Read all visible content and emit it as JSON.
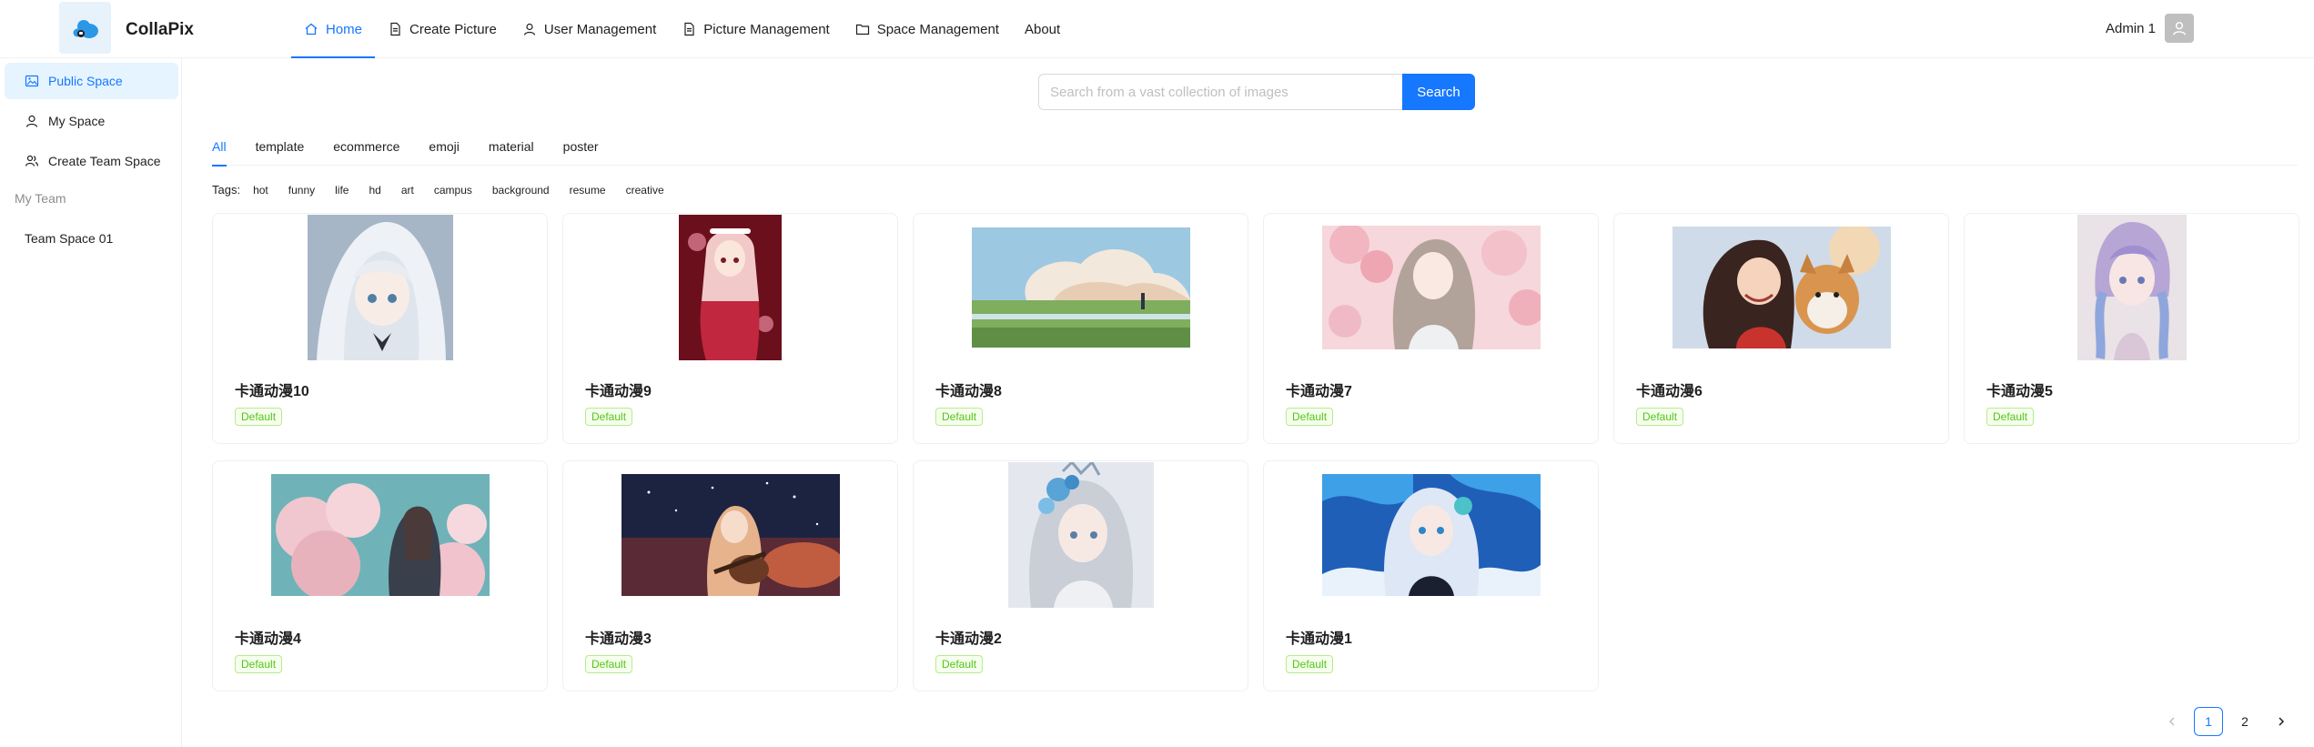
{
  "header": {
    "app_title": "CollaPix",
    "nav": [
      {
        "label": "Home",
        "icon": "home-icon",
        "active": true
      },
      {
        "label": "Create Picture",
        "icon": "file-icon"
      },
      {
        "label": "User Management",
        "icon": "user-icon"
      },
      {
        "label": "Picture Management",
        "icon": "file-icon"
      },
      {
        "label": "Space Management",
        "icon": "folder-icon"
      },
      {
        "label": "About",
        "icon": ""
      }
    ],
    "user_name": "Admin 1"
  },
  "sidebar": {
    "items": [
      {
        "label": "Public Space",
        "icon": "picture-icon",
        "active": true
      },
      {
        "label": "My Space",
        "icon": "user-icon"
      },
      {
        "label": "Create Team Space",
        "icon": "team-icon"
      }
    ],
    "group_title": "My Team",
    "team_items": [
      {
        "label": "Team Space 01"
      }
    ]
  },
  "search": {
    "placeholder": "Search from a vast collection of images",
    "button_label": "Search"
  },
  "categories": [
    "All",
    "template",
    "ecommerce",
    "emoji",
    "material",
    "poster"
  ],
  "tags": {
    "label": "Tags:",
    "items": [
      "hot",
      "funny",
      "life",
      "hd",
      "art",
      "campus",
      "background",
      "resume",
      "creative"
    ]
  },
  "pictures": [
    {
      "title": "卡通动漫10",
      "tag": "Default"
    },
    {
      "title": "卡通动漫9",
      "tag": "Default"
    },
    {
      "title": "卡通动漫8",
      "tag": "Default"
    },
    {
      "title": "卡通动漫7",
      "tag": "Default"
    },
    {
      "title": "卡通动漫6",
      "tag": "Default"
    },
    {
      "title": "卡通动漫5",
      "tag": "Default"
    },
    {
      "title": "卡通动漫4",
      "tag": "Default"
    },
    {
      "title": "卡通动漫3",
      "tag": "Default"
    },
    {
      "title": "卡通动漫2",
      "tag": "Default"
    },
    {
      "title": "卡通动漫1",
      "tag": "Default"
    }
  ],
  "pagination": {
    "pages": [
      "1",
      "2"
    ],
    "current": "1",
    "prev_icon": "chevron-left-icon",
    "next_icon": "chevron-right-icon"
  },
  "colors": {
    "accent": "#1677ff",
    "tag_green": "#52c41a",
    "sidebar_active_bg": "#e6f4ff"
  }
}
